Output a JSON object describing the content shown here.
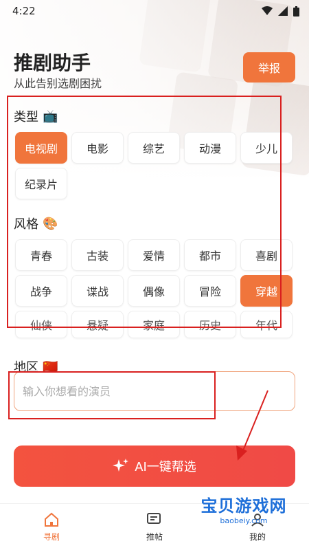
{
  "status_bar": {
    "time": "4:22"
  },
  "header": {
    "title": "推剧助手",
    "subtitle": "从此告别选剧困扰",
    "report_label": "举报"
  },
  "type_section": {
    "label": "类型",
    "emoji": "📺",
    "chips": [
      "电视剧",
      "电影",
      "综艺",
      "动漫",
      "少儿",
      "纪录片"
    ],
    "selected": "电视剧"
  },
  "style_section": {
    "label": "风格",
    "emoji": "🎨",
    "chips": [
      "青春",
      "古装",
      "爱情",
      "都市",
      "喜剧",
      "战争",
      "谍战",
      "偶像",
      "冒险",
      "穿越",
      "仙侠",
      "悬疑",
      "家庭",
      "历史",
      "年代"
    ],
    "selected": "穿越"
  },
  "region_section": {
    "label": "地区",
    "emoji": "🇨🇳",
    "actor_placeholder": "输入你想看的演员"
  },
  "ai_button": {
    "icon": "sparkle-icon",
    "label": "AI一键帮选"
  },
  "bottom_nav": {
    "items": [
      {
        "label": "寻剧",
        "icon": "home-icon",
        "active": true
      },
      {
        "label": "推帖",
        "icon": "chat-icon",
        "active": false
      },
      {
        "label": "我的",
        "icon": "profile-icon",
        "active": false
      }
    ]
  },
  "watermark": {
    "title": "宝贝游戏网",
    "url": "baobeiy.com"
  },
  "colors": {
    "accent": "#f0753c",
    "ai_button": "#f04a46",
    "annotation_red": "#d9201f",
    "watermark_blue": "#1e6fd9"
  }
}
